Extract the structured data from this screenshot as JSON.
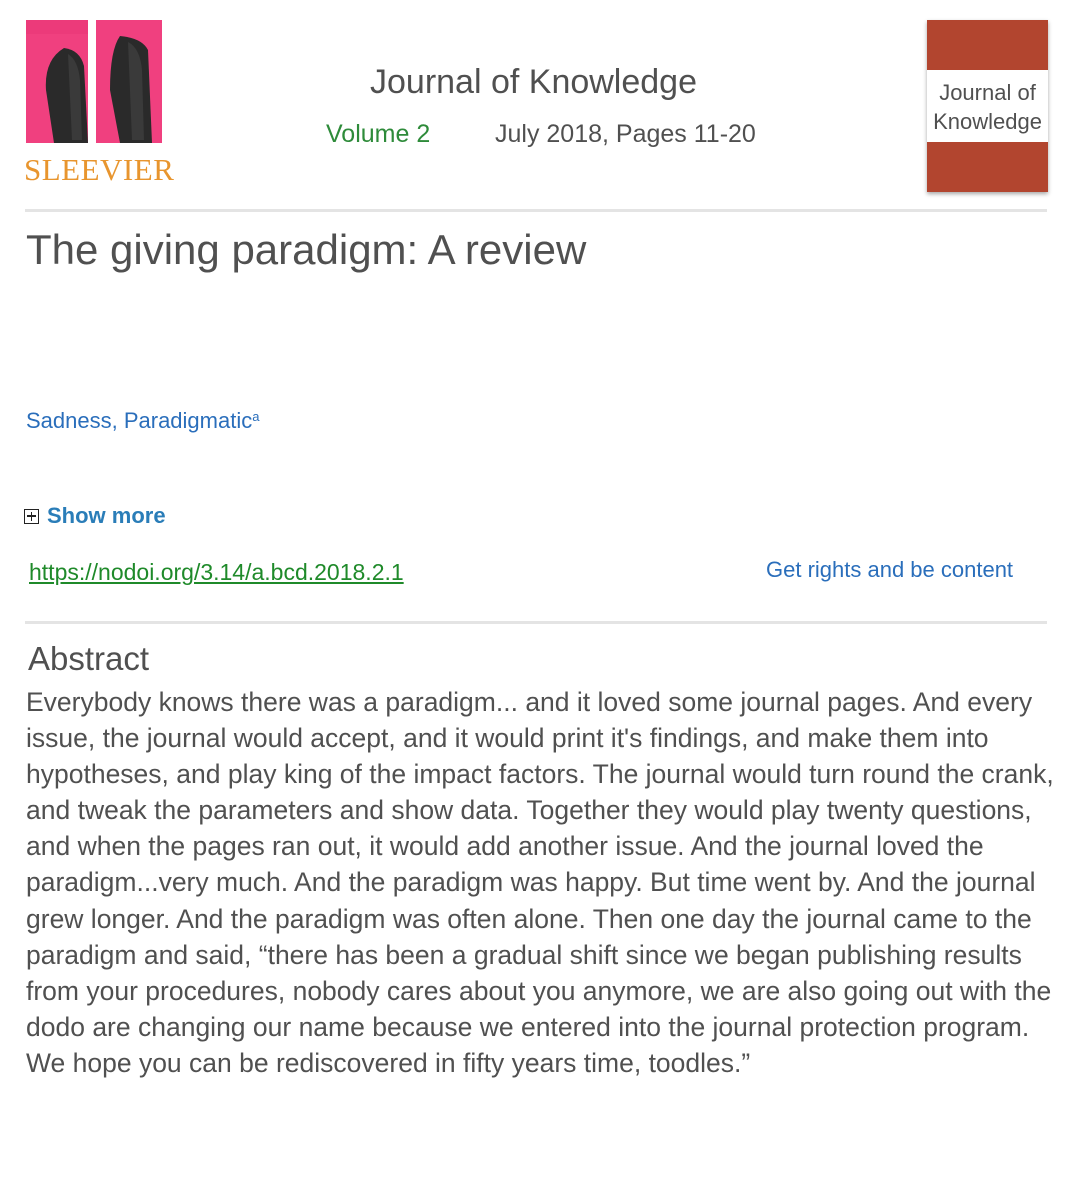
{
  "publisher": {
    "name": "SLEEVIER",
    "name_color": "#e8952e",
    "logo": "arm-sleeves-photo"
  },
  "journal": {
    "title": "Journal of Knowledge",
    "volume": "Volume 2",
    "volume_color": "#2e8b3a",
    "issue_info": "July 2018, Pages 11-20",
    "cover_title": "Journal of Knowledge",
    "cover_color": "#b2452f"
  },
  "article": {
    "title": "The giving paradigm: A review",
    "author": "Sadness, Paradigmatic",
    "author_affiliation": "a",
    "show_more": "Show more",
    "doi": "https://nodoi.org/3.14/a.bcd.2018.2.1",
    "doi_color": "#1f8a2a",
    "rights": "Get rights and be content"
  },
  "abstract": {
    "heading": "Abstract",
    "text": "Everybody knows there was a paradigm... and it loved some journal pages. And every issue, the journal would accept, and it would print it's findings, and make them into hypotheses, and play king of the impact factors. The journal would turn round the crank, and tweak the parameters and show data. Together they would play twenty questions, and when the pages ran out, it would add another issue. And the journal loved the paradigm...very much. And the paradigm was happy. But time went by. And the journal grew longer. And the paradigm was often alone. Then one day the journal came to the paradigm and said, “there has been a gradual shift since we began publishing results from your procedures, nobody cares about you anymore, we are also going out with the dodo are changing our name because we entered into the journal protection program. We hope you can be rediscovered in fifty years time, toodles.”"
  }
}
